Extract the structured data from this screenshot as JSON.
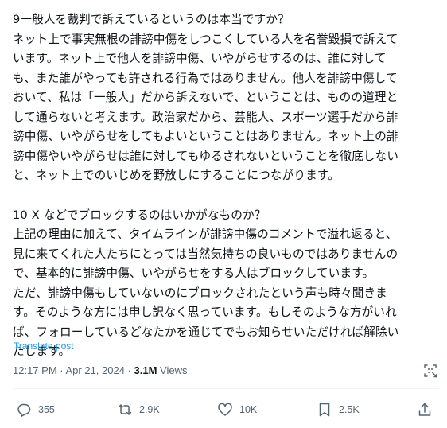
{
  "tweet": {
    "paragraphs": [
      {
        "lines": [
          "9一般人を裁判で訴えているというのは本当ですか？",
          "ネット上で事実無根の誹謗中傷をしつこくしている人を名誉毀損で訴えて",
          "います。ネット上で他人を誹謗中傷、いやがらせするのは、誰に対して",
          "も、また誰がやっても許される行為ではありません。他人を誹謗中傷して",
          "おいて、私は「一般人」だから訴えないで、ということは、ものの道理と",
          "して通らないと考えます。政治家だから、芸能人、スポーツ選手だから誹",
          "謗中傷、いやがらせをしてもよいということはありません。ネット上の誹",
          "謗中傷やいやがらせは誰に対してもゆるされないということを徹底しない",
          "と、ネット上でのいじめを野放しにすることにつながります。"
        ]
      },
      {
        "lines": [
          "10 X などでブロックするのはいかがなものか？",
          "上記の理由に加えて、タイムラインが誹謗中傷のコメントで溢れ返ると、",
          "見に来てくれた人たちにとっては当然気持ちの良いものではありませんの",
          "で、基本的に誹謗中傷、いやがらせをする人はブロックしています。",
          "ただ、誹謗中傷もしていないのにブロックされたという声も時々聞きま",
          "す。そのような方には申し訳なく思っています。もしそのような方がいれ",
          "ば、フォローしているどなたかを通じてでもお知らせいただければ解除い",
          "たします。"
        ]
      }
    ],
    "translate_label": "Translate post",
    "time": "12:17 PM",
    "separator": " · ",
    "date": "Apr 21, 2024",
    "views_count": "3.1M",
    "views_label": " Views"
  },
  "actions": {
    "reply": {
      "icon": "reply-icon",
      "count": "355"
    },
    "retweet": {
      "icon": "retweet-icon",
      "count": "2.9K"
    },
    "like": {
      "icon": "heart-icon",
      "count": "10K"
    },
    "bookmark": {
      "icon": "bookmark-icon",
      "count": "2.5K"
    },
    "share": {
      "icon": "share-icon"
    }
  },
  "colors": {
    "text": "#0f1419",
    "muted": "#536471",
    "link": "#1d9bf0",
    "divider": "#eff3f4"
  }
}
